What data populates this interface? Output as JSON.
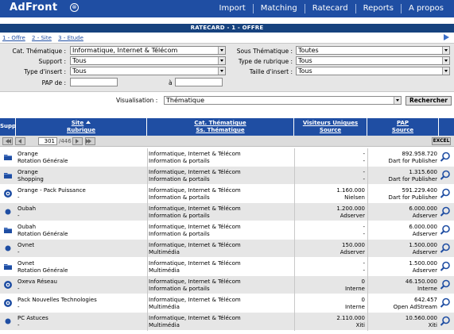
{
  "header": {
    "logo": "AdFront",
    "nav": [
      "Import",
      "Matching",
      "Ratecard",
      "Reports",
      "A propos"
    ]
  },
  "title": "RATECARD - 1 - OFFRE",
  "steps": [
    "1 - Offre",
    "2 - Site",
    "3 - Etude"
  ],
  "filters": {
    "cat_label": "Cat. Thématique :",
    "cat_value": "Informatique, Internet & Télécom",
    "sous_label": "Sous Thématique :",
    "sous_value": "Toutes",
    "support_label": "Support :",
    "support_value": "Tous",
    "type_rub_label": "Type de rubrique :",
    "type_rub_value": "Tous",
    "type_insert_label": "Type d'insert :",
    "type_insert_value": "Tous",
    "taille_label": "Taille d'insert :",
    "taille_value": "Tous",
    "pap_label": "PAP de :",
    "pap_to": "à",
    "vis_label": "Visualisation :",
    "vis_value": "Thématique",
    "search_label": "Rechercher"
  },
  "table": {
    "col_supp": "Supp",
    "col_site": "Site",
    "col_rubrique": "Rubrique",
    "col_cat": "Cat. Thématique",
    "col_sscat": "Ss. Thématique",
    "col_vis": "Visiteurs Uniques",
    "col_vis_src": "Source",
    "col_pap": "PAP",
    "col_pap_src": "Source",
    "page": "301",
    "page_total": "/446",
    "excel": "EXCEL",
    "rows": [
      {
        "icon": "folder",
        "site": "Orange",
        "rub": "Rotation Générale",
        "cat": "Informatique, Internet & Télécom",
        "sscat": "Information & portails",
        "vis": "-",
        "vis_src": "-",
        "pap": "892.958.720",
        "pap_src": "Dart for Publisher"
      },
      {
        "icon": "folder",
        "site": "Orange",
        "rub": "Shopping",
        "cat": "Informatique, Internet & Télécom",
        "sscat": "Information & portails",
        "vis": "-",
        "vis_src": "-",
        "pap": "1.315.600",
        "pap_src": "Dart for Publisher"
      },
      {
        "icon": "pack",
        "site": "Orange - Pack Puissance",
        "rub": "-",
        "cat": "Informatique, Internet & Télécom",
        "sscat": "Information & portails",
        "vis": "1.160.000",
        "vis_src": "Nielsen",
        "pap": "591.229.400",
        "pap_src": "Dart for Publisher"
      },
      {
        "icon": "dot",
        "site": "Oubah",
        "rub": "-",
        "cat": "Informatique, Internet & Télécom",
        "sscat": "Information & portails",
        "vis": "1.200.000",
        "vis_src": "Adserver",
        "pap": "6.000.000",
        "pap_src": "Adserver"
      },
      {
        "icon": "folder",
        "site": "Oubah",
        "rub": "Rotation Générale",
        "cat": "Informatique, Internet & Télécom",
        "sscat": "Information & portails",
        "vis": "-",
        "vis_src": "-",
        "pap": "6.000.000",
        "pap_src": "Adserver"
      },
      {
        "icon": "dot",
        "site": "Ovnet",
        "rub": "-",
        "cat": "Informatique, Internet & Télécom",
        "sscat": "Multimédia",
        "vis": "150.000",
        "vis_src": "Adserver",
        "pap": "1.500.000",
        "pap_src": "Adserver"
      },
      {
        "icon": "folder",
        "site": "Ovnet",
        "rub": "Rotation Générale",
        "cat": "Informatique, Internet & Télécom",
        "sscat": "Multimédia",
        "vis": "-",
        "vis_src": "-",
        "pap": "1.500.000",
        "pap_src": "Adserver"
      },
      {
        "icon": "pack",
        "site": "Oxeva Réseau",
        "rub": "-",
        "cat": "Informatique, Internet & Télécom",
        "sscat": "Information & portails",
        "vis": "0",
        "vis_src": "Interne",
        "pap": "46.150.000",
        "pap_src": "Interne"
      },
      {
        "icon": "pack",
        "site": "Pack Nouvelles Technologies",
        "rub": "-",
        "cat": "Informatique, Internet & Télécom",
        "sscat": "Multimédia",
        "vis": "0",
        "vis_src": "Interne",
        "pap": "642.457",
        "pap_src": "Open AdStream"
      },
      {
        "icon": "dot",
        "site": "PC Astuces",
        "rub": "-",
        "cat": "Informatique, Internet & Télécom",
        "sscat": "Multimédia",
        "vis": "2.110.000",
        "vis_src": "Xiti",
        "pap": "10.560.000",
        "pap_src": "Xiti"
      }
    ]
  }
}
